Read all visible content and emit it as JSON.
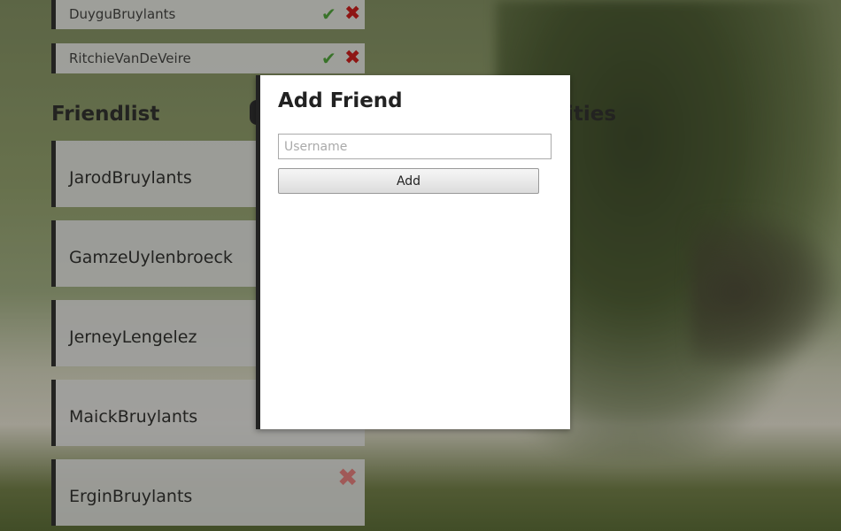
{
  "requests": [
    {
      "name": "DuyguBruylants",
      "accept_icon": "✔",
      "deny_icon": "✖"
    },
    {
      "name": "RitchieVanDeVeire",
      "accept_icon": "✔",
      "deny_icon": "✖"
    }
  ],
  "friendlist": {
    "title": "Friendlist",
    "items": [
      {
        "name": "JarodBruylants"
      },
      {
        "name": "GamzeUylenbroeck"
      },
      {
        "name": "JerneyLengelez"
      },
      {
        "name": "MaickBruylants"
      },
      {
        "name": "ErginBruylants",
        "remove_icon": "✖"
      }
    ]
  },
  "partial_title": "ities",
  "modal": {
    "title": "Add Friend",
    "username_placeholder": "Username",
    "username_value": "",
    "add_label": "Add"
  },
  "colors": {
    "accept": "#3f8d2e",
    "deny": "#b01010",
    "accent_border": "#222222"
  }
}
